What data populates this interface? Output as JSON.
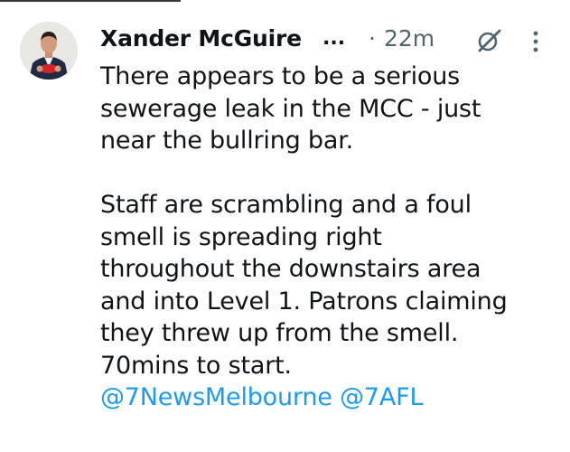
{
  "tweet": {
    "author": {
      "display_name": "Xander McGuire",
      "truncation": "...",
      "avatar_icon": "profile-photo"
    },
    "separator": "·",
    "timestamp": "22m",
    "icons": {
      "grok": "grok-slash-icon",
      "more": "more-vertical-icon"
    },
    "paragraph1": {
      "lines": [
        "There appears to be a serious",
        "sewerage leak in the MCC - just",
        "near the bullring bar."
      ]
    },
    "paragraph2": {
      "lines": [
        "Staff are scrambling and a foul",
        "smell is spreading right",
        "throughout the downstairs area",
        "and into Level 1. Patrons claiming",
        "they threw up from the smell.",
        "70mins to start."
      ]
    },
    "mentions": [
      "@7NewsMelbourne",
      "@7AFL"
    ]
  },
  "colors": {
    "text": "#0f1419",
    "secondary": "#536471",
    "link": "#1d9bf0",
    "background": "#ffffff"
  }
}
